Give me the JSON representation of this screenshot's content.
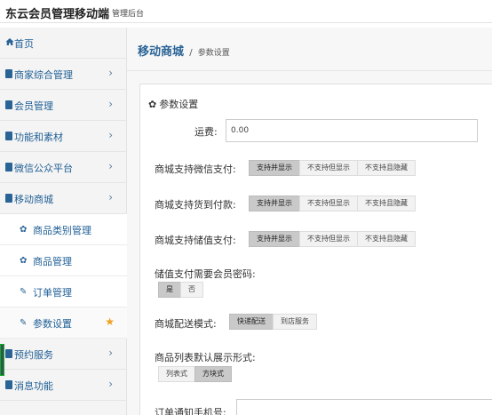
{
  "header": {
    "title": "东云会员管理移动端",
    "subtitle": "管理后台"
  },
  "sidebar": {
    "items": [
      {
        "label": "首页",
        "icon": "home-icon",
        "expandable": false
      },
      {
        "label": "商家综合管理",
        "icon": "file-icon",
        "expandable": true
      },
      {
        "label": "会员管理",
        "icon": "file-icon",
        "expandable": true
      },
      {
        "label": "功能和素材",
        "icon": "file-icon",
        "expandable": true
      },
      {
        "label": "微信公众平台",
        "icon": "file-icon",
        "expandable": true
      },
      {
        "label": "移动商城",
        "icon": "file-icon",
        "expandable": true
      }
    ],
    "subitems": [
      {
        "label": "商品类别管理",
        "icon": "gear-icon"
      },
      {
        "label": "商品管理",
        "icon": "gear-icon"
      },
      {
        "label": "订单管理",
        "icon": "edit-icon"
      },
      {
        "label": "参数设置",
        "icon": "edit-icon",
        "active": true,
        "favorite_icon": "star-icon"
      }
    ],
    "items_after": [
      {
        "label": "预约服务",
        "icon": "file-icon",
        "expandable": true
      },
      {
        "label": "消息功能",
        "icon": "file-icon",
        "expandable": true
      }
    ],
    "chevron": "›"
  },
  "breadcrumb": {
    "section": "移动商城",
    "separator": "/",
    "page": "参数设置"
  },
  "panel": {
    "title": "参数设置",
    "shipping": {
      "label": "运费:",
      "value": "0.00"
    },
    "wechat_pay": {
      "label": "商城支持微信支付:",
      "options": [
        "支持并显示",
        "不支持但显示",
        "不支持且隐藏"
      ],
      "selected": 0
    },
    "cod": {
      "label": "商城支持货到付款:",
      "options": [
        "支持并显示",
        "不支持但显示",
        "不支持且隐藏"
      ],
      "selected": 0
    },
    "stored_value": {
      "label": "商城支持储值支付:",
      "options": [
        "支持并显示",
        "不支持但显示",
        "不支持且隐藏"
      ],
      "selected": 0
    },
    "pay_password": {
      "label": "储值支付需要会员密码:",
      "options": [
        "是",
        "否"
      ],
      "selected": 0
    },
    "delivery": {
      "label": "商城配送模式:",
      "options": [
        "快递配送",
        "到店服务"
      ],
      "selected": 0
    },
    "list_style": {
      "label": "商品列表默认展示形式:",
      "options": [
        "列表式",
        "方块式"
      ],
      "selected": 1
    },
    "order_phone": {
      "label": "订单通知手机号:",
      "value": ""
    }
  },
  "colors": {
    "accent": "#2a6496",
    "star": "#f0a020",
    "selected_button": "#c9c9c9"
  }
}
